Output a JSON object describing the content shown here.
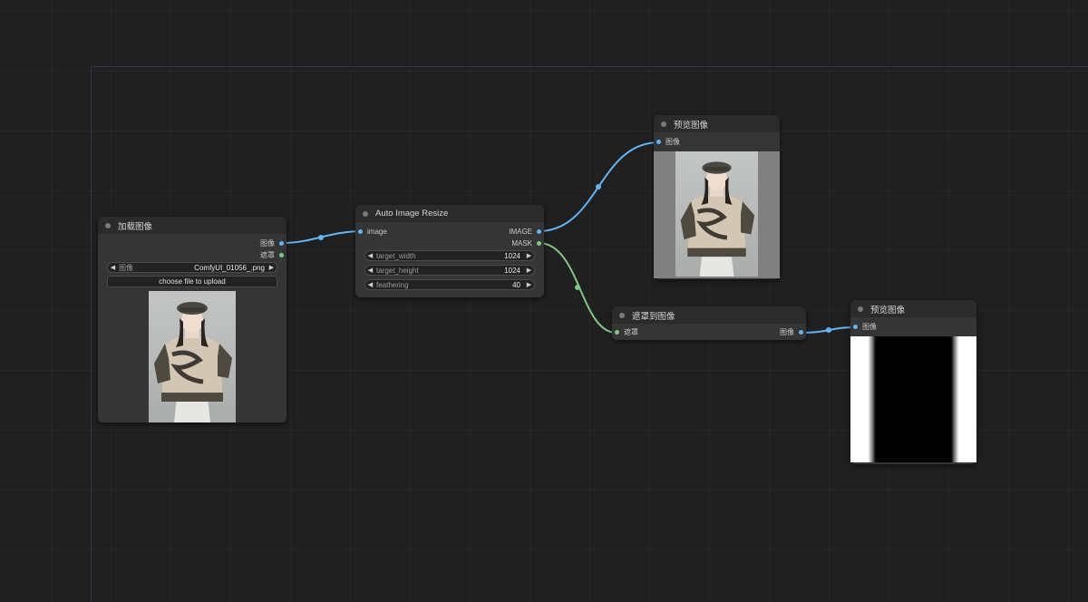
{
  "nodes": {
    "load_image": {
      "title": "加载图像",
      "outputs": [
        "图像",
        "遮罩"
      ],
      "image_widget": {
        "label": "图像",
        "value": "ComfyUI_01056_.png"
      },
      "upload_button": "choose file to upload"
    },
    "auto_resize": {
      "title": "Auto Image Resize",
      "input": "image",
      "outputs": [
        "IMAGE",
        "MASK"
      ],
      "widgets": [
        {
          "label": "target_width",
          "value": "1024"
        },
        {
          "label": "target_height",
          "value": "1024"
        },
        {
          "label": "feathering",
          "value": "40"
        }
      ]
    },
    "preview_top": {
      "title": "预览图像",
      "input": "图像"
    },
    "mask_to_image": {
      "title": "遮罩到图像",
      "input": "遮罩",
      "output": "图像"
    },
    "preview_mask": {
      "title": "预览图像",
      "input": "图像"
    }
  },
  "colors": {
    "image_link": "#64b5f6",
    "mask_link": "#81c784",
    "canvas": "#202020",
    "node": "#353535"
  },
  "icons": {
    "decrement": "left-arrow-icon",
    "increment": "right-arrow-icon"
  }
}
